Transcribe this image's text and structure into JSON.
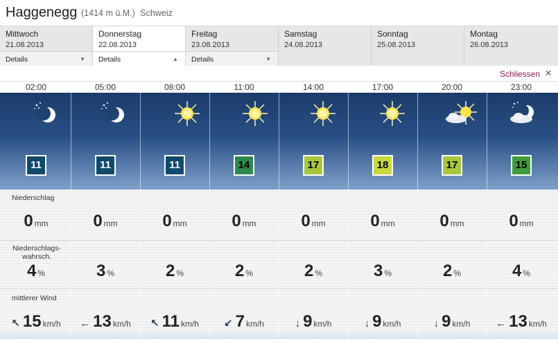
{
  "header": {
    "title": "Haggenegg",
    "elevation": "(1414 m ü.M.)",
    "country": "Schweiz"
  },
  "days": [
    {
      "name": "Mittwoch",
      "date": "21.08.2013",
      "details": "Details",
      "caret": "▼",
      "active": false
    },
    {
      "name": "Donnerstag",
      "date": "22.08.2013",
      "details": "Details",
      "caret": "▲",
      "active": true
    },
    {
      "name": "Freitag",
      "date": "23.08.2013",
      "details": "Details",
      "caret": "▼",
      "active": false
    },
    {
      "name": "Samstag",
      "date": "24.08.2013"
    },
    {
      "name": "Sonntag",
      "date": "25.08.2013"
    },
    {
      "name": "Montag",
      "date": "26.08.2013"
    }
  ],
  "close": {
    "label": "Schliessen",
    "icon": "×"
  },
  "row_labels": {
    "precip": "Niederschlag",
    "prob_line1": "Niederschlags-",
    "prob_line2": "wahrsch.",
    "wind": "mittlerer Wind"
  },
  "units": {
    "precip": "mm",
    "prob": "%",
    "wind": "km/h"
  },
  "forecast": [
    {
      "time": "02:00",
      "icon": "moon-stars-icon",
      "temp": "11",
      "precip": "0",
      "prob": "4",
      "wind": "15",
      "dir": "↖"
    },
    {
      "time": "05:00",
      "icon": "moon-stars-icon",
      "temp": "11",
      "precip": "0",
      "prob": "3",
      "wind": "13",
      "dir": "←"
    },
    {
      "time": "08:00",
      "icon": "sun-icon",
      "temp": "11",
      "precip": "0",
      "prob": "2",
      "wind": "11",
      "dir": "↖"
    },
    {
      "time": "11:00",
      "icon": "sun-icon",
      "temp": "14",
      "precip": "0",
      "prob": "2",
      "wind": "7",
      "dir": "↙"
    },
    {
      "time": "14:00",
      "icon": "sun-icon",
      "temp": "17",
      "precip": "0",
      "prob": "2",
      "wind": "9",
      "dir": "↓"
    },
    {
      "time": "17:00",
      "icon": "sun-icon",
      "temp": "18",
      "precip": "0",
      "prob": "3",
      "wind": "9",
      "dir": "↓"
    },
    {
      "time": "20:00",
      "icon": "sun-cloud-icon",
      "temp": "17",
      "precip": "0",
      "prob": "2",
      "wind": "9",
      "dir": "↓"
    },
    {
      "time": "23:00",
      "icon": "moon-cloud-icon",
      "temp": "15",
      "precip": "0",
      "prob": "4",
      "wind": "13",
      "dir": "←"
    }
  ]
}
